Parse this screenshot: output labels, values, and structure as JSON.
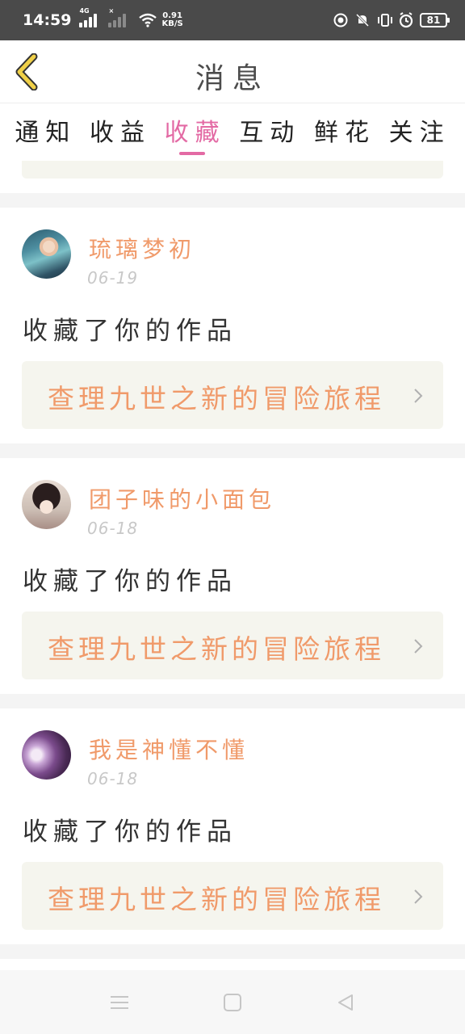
{
  "status_bar": {
    "time": "14:59",
    "network_tag": "4G",
    "sim2_tag": "×",
    "speed_value": "0.91",
    "speed_unit": "KB/S",
    "battery": "81",
    "icons": [
      "signal-icon",
      "wifi-icon",
      "record-icon",
      "mute-icon",
      "vibrate-icon",
      "alarm-icon",
      "battery-icon"
    ]
  },
  "header": {
    "title": "消息",
    "back_icon": "chevron-left-icon",
    "accent": "#f0d048"
  },
  "tabs": [
    {
      "label": "通知",
      "active": false
    },
    {
      "label": "收益",
      "active": false
    },
    {
      "label": "收藏",
      "active": true
    },
    {
      "label": "互动",
      "active": false
    },
    {
      "label": "鲜花",
      "active": false
    },
    {
      "label": "关注",
      "active": false
    }
  ],
  "messages": [
    {
      "username": "琉璃梦初",
      "date": "06-19",
      "action": "收藏了你的作品",
      "work_title": "查理九世之新的冒险旅程"
    },
    {
      "username": "团子味的小面包",
      "date": "06-18",
      "action": "收藏了你的作品",
      "work_title": "查理九世之新的冒险旅程"
    },
    {
      "username": "我是神懂不懂",
      "date": "06-18",
      "action": "收藏了你的作品",
      "work_title": "查理九世之新的冒险旅程"
    }
  ],
  "nav_bar": {
    "icons": [
      "menu-icon",
      "home-icon",
      "back-icon"
    ]
  },
  "colors": {
    "tab_active": "#e36aa4",
    "name": "#f09a6a",
    "card_bg": "#f5f5ee"
  }
}
